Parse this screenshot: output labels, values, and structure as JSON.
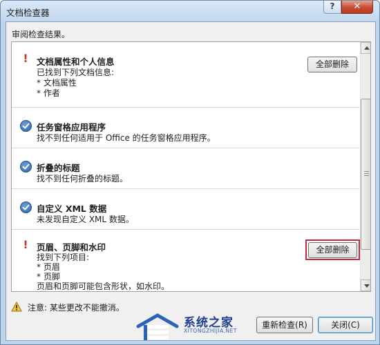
{
  "window": {
    "title": "文档检查器",
    "help_label": "?",
    "close_glyph": "✕"
  },
  "heading": "审阅检查结果。",
  "items": [
    {
      "status": "issue",
      "title": "文档属性和个人信息",
      "lines": [
        "已找到下列文档信息:",
        "* 文档属性",
        "* 作者"
      ],
      "button": "全部删除"
    },
    {
      "status": "ok",
      "title": "任务窗格应用程序",
      "lines": [
        "找不到任何适用于 Office 的任务窗格应用程序。"
      ]
    },
    {
      "status": "ok",
      "title": "折叠的标题",
      "lines": [
        "找不到任何折叠的标题。"
      ]
    },
    {
      "status": "ok",
      "title": "自定义 XML 数据",
      "lines": [
        "未发现自定义 XML 数据。"
      ]
    },
    {
      "status": "issue",
      "title": "页眉、页脚和水印",
      "lines": [
        "找到下列项目:",
        "* 页眉",
        "* 页脚",
        "页眉和页脚可能包含形状，如水印。"
      ],
      "button": "全部删除",
      "highlighted": true
    }
  ],
  "footer": {
    "warning": "注意: 某些更改不能撤消。",
    "reinspect_button": "重新检查(R)",
    "close_button": "关闭(C)"
  },
  "watermark": {
    "text": "系统之家",
    "subtext": "XITONGZHIJIA.NET"
  },
  "colors": {
    "issue_icon": "#c6372a",
    "ok_icon": "#2e66a8",
    "highlight_outline": "#c8263c",
    "titlebar": "#c2d7ee"
  }
}
